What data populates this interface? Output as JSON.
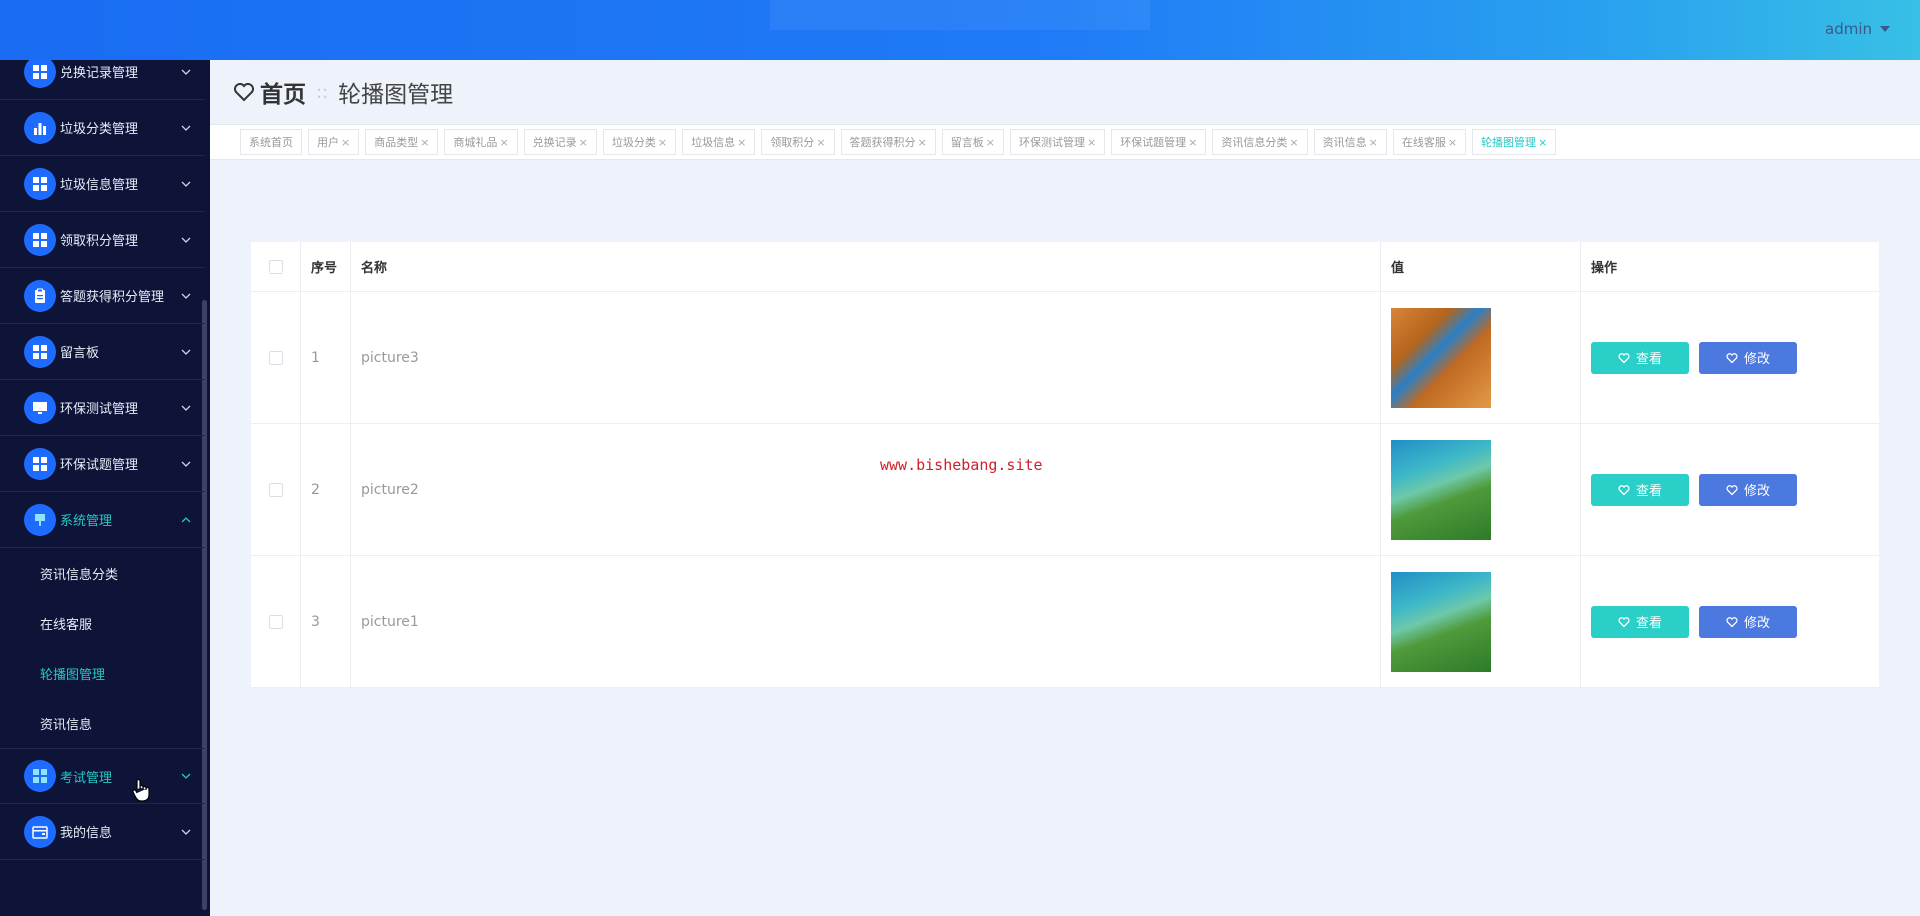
{
  "topbar": {
    "user": "admin"
  },
  "sidebar": {
    "items": [
      {
        "label": "兑换记录管理",
        "icon": "grid-icon"
      },
      {
        "label": "垃圾分类管理",
        "icon": "bar-chart-icon"
      },
      {
        "label": "垃圾信息管理",
        "icon": "grid-icon"
      },
      {
        "label": "领取积分管理",
        "icon": "grid-icon"
      },
      {
        "label": "答题获得积分管理",
        "icon": "clipboard-icon"
      },
      {
        "label": "留言板",
        "icon": "grid-icon"
      },
      {
        "label": "环保测试管理",
        "icon": "monitor-icon"
      },
      {
        "label": "环保试题管理",
        "icon": "grid-icon"
      },
      {
        "label": "系统管理",
        "icon": "pin-icon"
      }
    ],
    "sub_items": [
      {
        "label": "资讯信息分类"
      },
      {
        "label": "在线客服"
      },
      {
        "label": "轮播图管理"
      },
      {
        "label": "资讯信息"
      }
    ],
    "bottom_items": [
      {
        "label": "考试管理",
        "icon": "grid-icon"
      },
      {
        "label": "我的信息",
        "icon": "wallet-icon"
      }
    ]
  },
  "header": {
    "home": "首页",
    "separator": "::",
    "current": "轮播图管理"
  },
  "tags": [
    "系统首页",
    "用户",
    "商品类型",
    "商城礼品",
    "兑换记录",
    "垃圾分类",
    "垃圾信息",
    "领取积分",
    "答题获得积分",
    "留言板",
    "环保测试管理",
    "环保试题管理",
    "资讯信息分类",
    "资讯信息",
    "在线客服",
    "轮播图管理"
  ],
  "table": {
    "headers": {
      "index": "序号",
      "name": "名称",
      "value": "值",
      "actions": "操作"
    },
    "rows": [
      {
        "index": "1",
        "name": "picture3",
        "image": "autumn"
      },
      {
        "index": "2",
        "name": "picture2",
        "image": "coast"
      },
      {
        "index": "3",
        "name": "picture1",
        "image": "coast"
      }
    ],
    "view_label": "查看",
    "edit_label": "修改"
  },
  "watermark": "www.bishebang.site",
  "colors": {
    "accent": "#27c7c4",
    "primary": "#4c79e0",
    "sidebar": "#0d1438",
    "topbar": "#1a6cf2"
  }
}
